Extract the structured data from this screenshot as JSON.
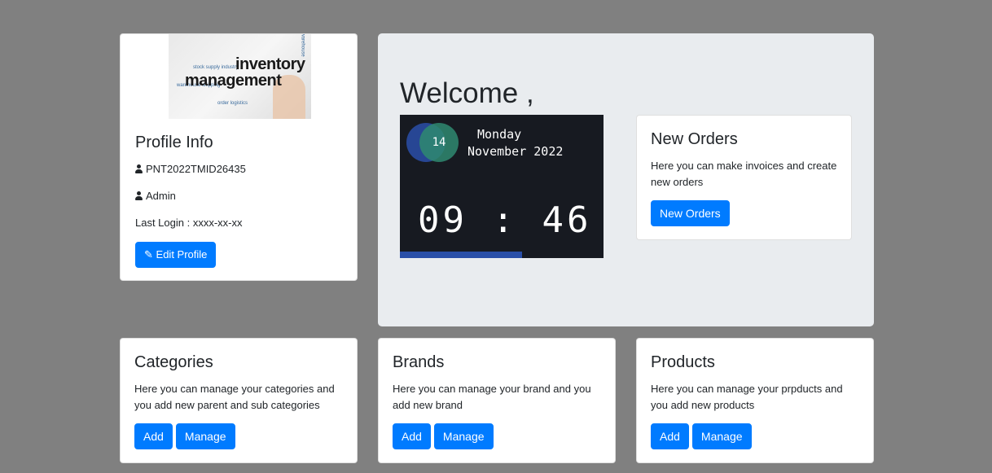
{
  "profile": {
    "logo_words": [
      "inventory",
      "management"
    ],
    "title": "Profile Info",
    "user_id": "PNT2022TMID26435",
    "role": "Admin",
    "last_login": "Last Login : xxxx-xx-xx",
    "edit_button": "Edit Profile"
  },
  "welcome": {
    "title": "Welcome ,",
    "clock": {
      "day_number": "14",
      "day_name": "Monday",
      "month_year": "November 2022",
      "time": "09 : 46",
      "progress_fraction": 0.6
    }
  },
  "new_orders": {
    "title": "New Orders",
    "text": "Here you can make invoices and create new orders",
    "button": "New Orders"
  },
  "categories": {
    "title": "Categories",
    "text": "Here you can manage your categories and you add new parent and sub categories",
    "add": "Add",
    "manage": "Manage"
  },
  "brands": {
    "title": "Brands",
    "text": "Here you can manage your brand and you add new brand",
    "add": "Add",
    "manage": "Manage"
  },
  "products": {
    "title": "Products",
    "text": "Here you can manage your prpducts and you add new products",
    "add": "Add",
    "manage": "Manage"
  },
  "colors": {
    "background": "#808080",
    "primary": "#007bff",
    "jumbotron": "#e9ecef",
    "clock_bg": "#171a21"
  },
  "icons": {
    "user": "user-icon",
    "edit": "edit-icon"
  }
}
